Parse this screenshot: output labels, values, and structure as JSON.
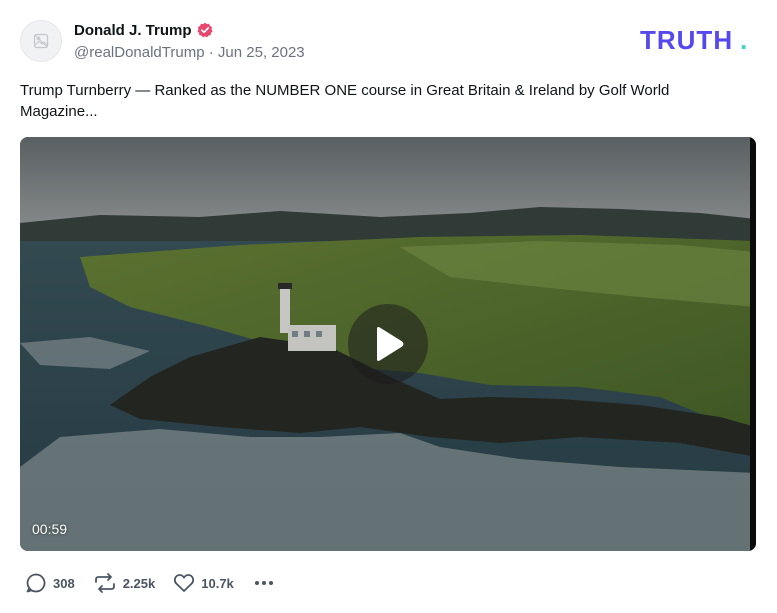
{
  "author": {
    "display_name": "Donald J. Trump",
    "handle": "@realDonaldTrump",
    "separator": " · ",
    "date": "Jun 25, 2023"
  },
  "brand": {
    "text": "TRUTH",
    "dot": ".",
    "color": "#5448ee",
    "dot_color": "#3fd0c9"
  },
  "post": {
    "text": "Trump Turnberry — Ranked as the NUMBER ONE course in Great Britain & Ireland by Golf World Magazine..."
  },
  "video": {
    "duration": "00:59",
    "play_icon": "play-icon"
  },
  "actions": {
    "replies": "308",
    "retruths": "2.25k",
    "likes": "10.7k"
  },
  "colors": {
    "verified": "#e9466d",
    "muted_text": "#6b7280"
  }
}
